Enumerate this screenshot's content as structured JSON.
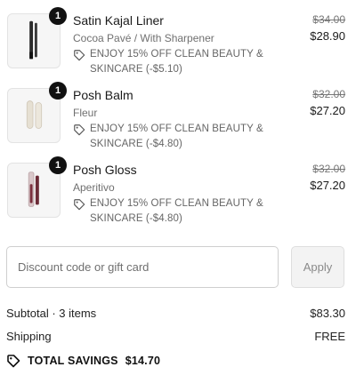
{
  "items": [
    {
      "name": "Satin Kajal Liner",
      "variant": "Cocoa Pavé / With Sharpener",
      "quantity": "1",
      "discount": "ENJOY 15% OFF CLEAN BEAUTY & SKINCARE (-$5.10)",
      "original_price": "$34.00",
      "price": "$28.90"
    },
    {
      "name": "Posh Balm",
      "variant": "Fleur",
      "quantity": "1",
      "discount": "ENJOY 15% OFF CLEAN BEAUTY & SKINCARE (-$4.80)",
      "original_price": "$32.00",
      "price": "$27.20"
    },
    {
      "name": "Posh Gloss",
      "variant": "Aperitivo",
      "quantity": "1",
      "discount": "ENJOY 15% OFF CLEAN BEAUTY & SKINCARE (-$4.80)",
      "original_price": "$32.00",
      "price": "$27.20"
    }
  ],
  "discount_code": {
    "placeholder": "Discount code or gift card",
    "value": "",
    "apply_label": "Apply"
  },
  "summary": {
    "subtotal_label": "Subtotal · 3 items",
    "subtotal_value": "$83.30",
    "shipping_label": "Shipping",
    "shipping_value": "FREE",
    "savings_label": "TOTAL SAVINGS",
    "savings_value": "$14.70"
  },
  "icons": {
    "tag": "tag-icon",
    "kajal": "kajal-liner-product-image",
    "balm": "posh-balm-product-image",
    "gloss": "posh-gloss-product-image"
  },
  "colors": {
    "badge": "#111111",
    "border": "#cfcfcf",
    "muted_text": "#707070"
  }
}
